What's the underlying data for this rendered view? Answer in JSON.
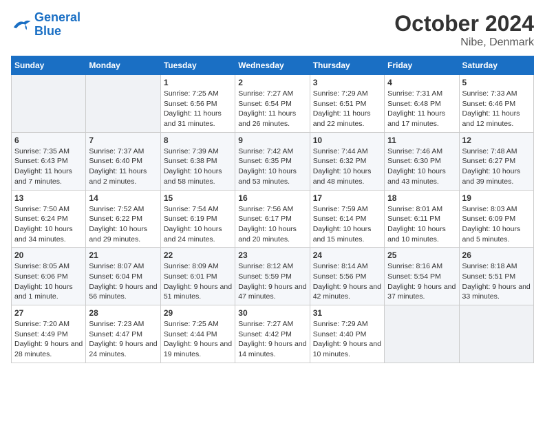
{
  "header": {
    "logo_line1": "General",
    "logo_line2": "Blue",
    "title": "October 2024",
    "subtitle": "Nibe, Denmark"
  },
  "days_of_week": [
    "Sunday",
    "Monday",
    "Tuesday",
    "Wednesday",
    "Thursday",
    "Friday",
    "Saturday"
  ],
  "weeks": [
    [
      {
        "day": "",
        "info": ""
      },
      {
        "day": "",
        "info": ""
      },
      {
        "day": "1",
        "info": "Sunrise: 7:25 AM\nSunset: 6:56 PM\nDaylight: 11 hours and 31 minutes."
      },
      {
        "day": "2",
        "info": "Sunrise: 7:27 AM\nSunset: 6:54 PM\nDaylight: 11 hours and 26 minutes."
      },
      {
        "day": "3",
        "info": "Sunrise: 7:29 AM\nSunset: 6:51 PM\nDaylight: 11 hours and 22 minutes."
      },
      {
        "day": "4",
        "info": "Sunrise: 7:31 AM\nSunset: 6:48 PM\nDaylight: 11 hours and 17 minutes."
      },
      {
        "day": "5",
        "info": "Sunrise: 7:33 AM\nSunset: 6:46 PM\nDaylight: 11 hours and 12 minutes."
      }
    ],
    [
      {
        "day": "6",
        "info": "Sunrise: 7:35 AM\nSunset: 6:43 PM\nDaylight: 11 hours and 7 minutes."
      },
      {
        "day": "7",
        "info": "Sunrise: 7:37 AM\nSunset: 6:40 PM\nDaylight: 11 hours and 2 minutes."
      },
      {
        "day": "8",
        "info": "Sunrise: 7:39 AM\nSunset: 6:38 PM\nDaylight: 10 hours and 58 minutes."
      },
      {
        "day": "9",
        "info": "Sunrise: 7:42 AM\nSunset: 6:35 PM\nDaylight: 10 hours and 53 minutes."
      },
      {
        "day": "10",
        "info": "Sunrise: 7:44 AM\nSunset: 6:32 PM\nDaylight: 10 hours and 48 minutes."
      },
      {
        "day": "11",
        "info": "Sunrise: 7:46 AM\nSunset: 6:30 PM\nDaylight: 10 hours and 43 minutes."
      },
      {
        "day": "12",
        "info": "Sunrise: 7:48 AM\nSunset: 6:27 PM\nDaylight: 10 hours and 39 minutes."
      }
    ],
    [
      {
        "day": "13",
        "info": "Sunrise: 7:50 AM\nSunset: 6:24 PM\nDaylight: 10 hours and 34 minutes."
      },
      {
        "day": "14",
        "info": "Sunrise: 7:52 AM\nSunset: 6:22 PM\nDaylight: 10 hours and 29 minutes."
      },
      {
        "day": "15",
        "info": "Sunrise: 7:54 AM\nSunset: 6:19 PM\nDaylight: 10 hours and 24 minutes."
      },
      {
        "day": "16",
        "info": "Sunrise: 7:56 AM\nSunset: 6:17 PM\nDaylight: 10 hours and 20 minutes."
      },
      {
        "day": "17",
        "info": "Sunrise: 7:59 AM\nSunset: 6:14 PM\nDaylight: 10 hours and 15 minutes."
      },
      {
        "day": "18",
        "info": "Sunrise: 8:01 AM\nSunset: 6:11 PM\nDaylight: 10 hours and 10 minutes."
      },
      {
        "day": "19",
        "info": "Sunrise: 8:03 AM\nSunset: 6:09 PM\nDaylight: 10 hours and 5 minutes."
      }
    ],
    [
      {
        "day": "20",
        "info": "Sunrise: 8:05 AM\nSunset: 6:06 PM\nDaylight: 10 hours and 1 minute."
      },
      {
        "day": "21",
        "info": "Sunrise: 8:07 AM\nSunset: 6:04 PM\nDaylight: 9 hours and 56 minutes."
      },
      {
        "day": "22",
        "info": "Sunrise: 8:09 AM\nSunset: 6:01 PM\nDaylight: 9 hours and 51 minutes."
      },
      {
        "day": "23",
        "info": "Sunrise: 8:12 AM\nSunset: 5:59 PM\nDaylight: 9 hours and 47 minutes."
      },
      {
        "day": "24",
        "info": "Sunrise: 8:14 AM\nSunset: 5:56 PM\nDaylight: 9 hours and 42 minutes."
      },
      {
        "day": "25",
        "info": "Sunrise: 8:16 AM\nSunset: 5:54 PM\nDaylight: 9 hours and 37 minutes."
      },
      {
        "day": "26",
        "info": "Sunrise: 8:18 AM\nSunset: 5:51 PM\nDaylight: 9 hours and 33 minutes."
      }
    ],
    [
      {
        "day": "27",
        "info": "Sunrise: 7:20 AM\nSunset: 4:49 PM\nDaylight: 9 hours and 28 minutes."
      },
      {
        "day": "28",
        "info": "Sunrise: 7:23 AM\nSunset: 4:47 PM\nDaylight: 9 hours and 24 minutes."
      },
      {
        "day": "29",
        "info": "Sunrise: 7:25 AM\nSunset: 4:44 PM\nDaylight: 9 hours and 19 minutes."
      },
      {
        "day": "30",
        "info": "Sunrise: 7:27 AM\nSunset: 4:42 PM\nDaylight: 9 hours and 14 minutes."
      },
      {
        "day": "31",
        "info": "Sunrise: 7:29 AM\nSunset: 4:40 PM\nDaylight: 9 hours and 10 minutes."
      },
      {
        "day": "",
        "info": ""
      },
      {
        "day": "",
        "info": ""
      }
    ]
  ]
}
